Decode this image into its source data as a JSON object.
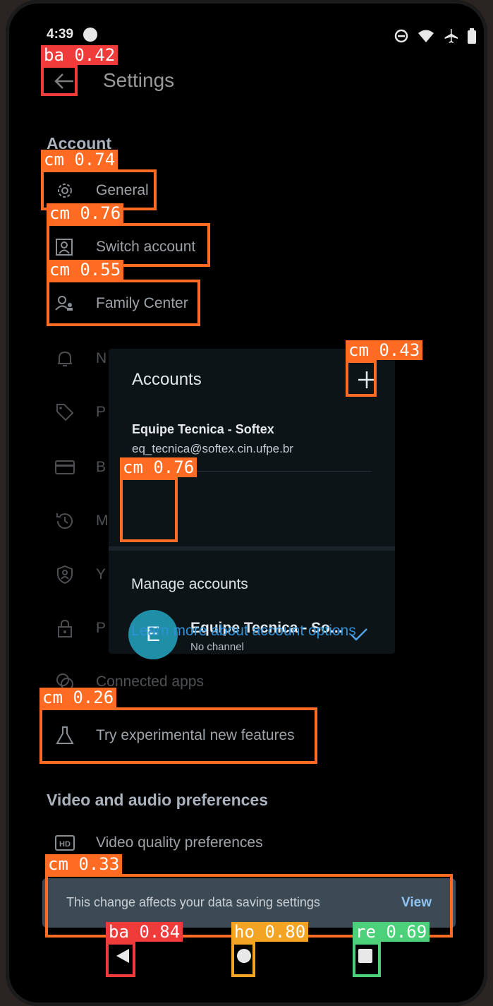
{
  "status": {
    "time": "4:39"
  },
  "header": {
    "title": "Settings"
  },
  "sections": {
    "account": "Account",
    "video_audio": "Video and audio preferences"
  },
  "settings": {
    "general": "General",
    "switch_account": "Switch account",
    "family_center": "Family Center",
    "notifications": "N",
    "purchases": "P",
    "billing": "B",
    "manage_history": "M",
    "your_data": "Y",
    "privacy": "P",
    "connected_apps": "Connected apps",
    "experimental": "Try experimental new features",
    "video_quality": "Video quality preferences"
  },
  "accounts_dialog": {
    "title": "Accounts",
    "account_name": "Equipe Tecnica - Softex",
    "account_email": "eq_tecnica@softex.cin.ufpe.br",
    "avatar_letter": "E",
    "channel_name": "Equipe Tecnica - So...",
    "channel_status": "No channel",
    "manage_accounts": "Manage accounts",
    "learn_more": "Learn more about account options"
  },
  "snackbar": {
    "text": "This change affects your data saving settings",
    "action": "View"
  },
  "detections": [
    {
      "label": "ba",
      "score": "0.42",
      "color": "#f03b3b"
    },
    {
      "label": "cm",
      "score": "0.74",
      "color": "#ff6b22"
    },
    {
      "label": "cm",
      "score": "0.76",
      "color": "#ff6b22"
    },
    {
      "label": "cm",
      "score": "0.55",
      "color": "#ff6b22"
    },
    {
      "label": "cm",
      "score": "0.43",
      "color": "#ff6b22"
    },
    {
      "label": "cm",
      "score": "0.76",
      "color": "#ff6b22"
    },
    {
      "label": "cm",
      "score": "0.26",
      "color": "#ff6b22"
    },
    {
      "label": "cm",
      "score": "0.33",
      "color": "#ff6b22"
    },
    {
      "label": "ba",
      "score": "0.84",
      "color": "#f03b3b"
    },
    {
      "label": "ho",
      "score": "0.80",
      "color": "#f2a422"
    },
    {
      "label": "re",
      "score": "0.69",
      "color": "#4cd17a"
    }
  ]
}
